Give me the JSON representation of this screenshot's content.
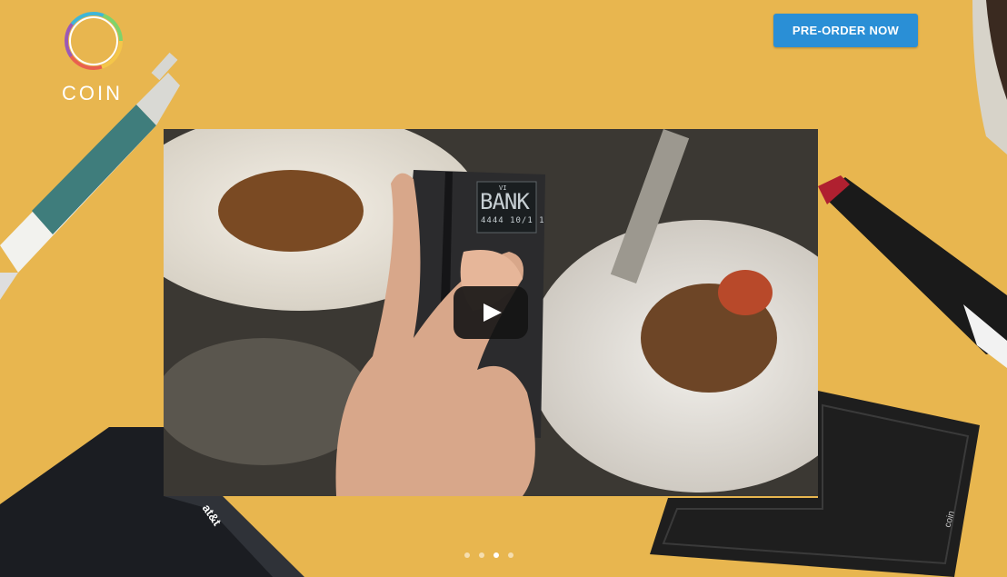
{
  "brand": {
    "name": "COIN",
    "logo_ring_colors": [
      "#f4c64a",
      "#e9604f",
      "#9b59b6",
      "#3fb6d8",
      "#7ed36c"
    ]
  },
  "header": {
    "cta_label": "PRE-ORDER NOW",
    "cta_color": "#2a8fd6"
  },
  "video": {
    "card_display": {
      "top_label": "VI",
      "bank_text": "BANK",
      "number_text": "4444 10/1 1"
    },
    "play_icon": "play-icon"
  },
  "carousel": {
    "slide_count": 4,
    "active_index": 2
  },
  "props": {
    "phone_carrier": "at&t",
    "device_brand": "coin"
  },
  "colors": {
    "background": "#e8b64f",
    "accent": "#2a8fd6"
  }
}
